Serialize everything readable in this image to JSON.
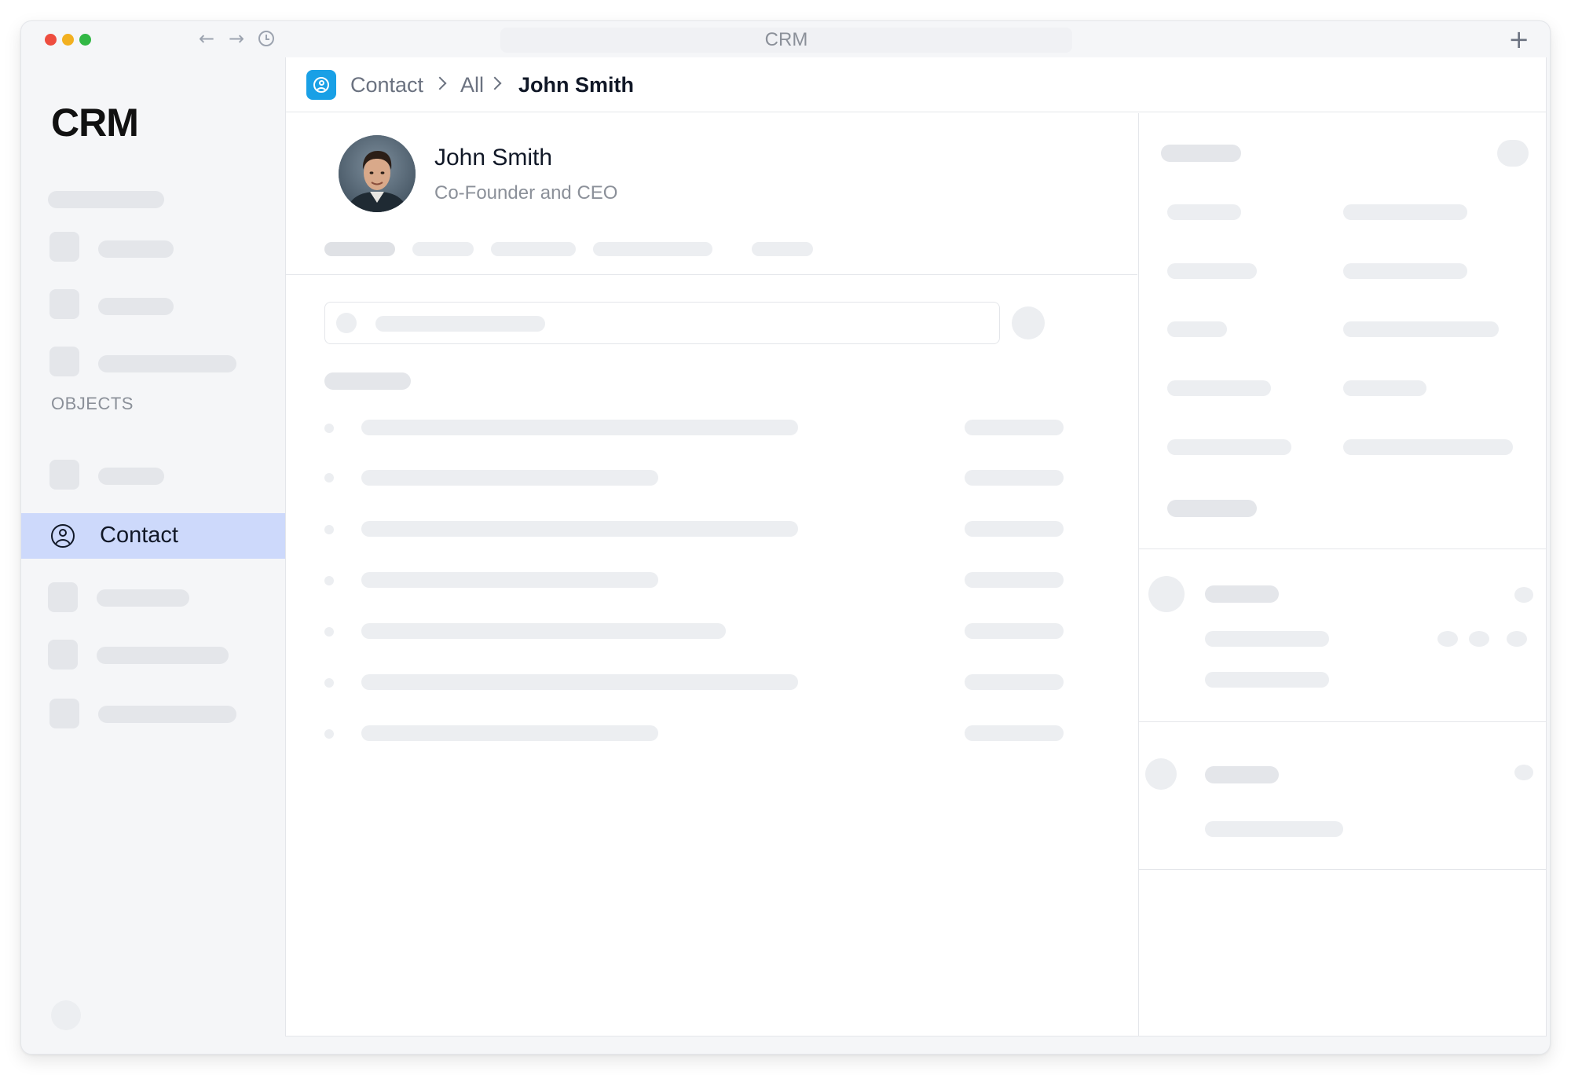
{
  "window": {
    "title": "CRM",
    "new_tab_label": "+",
    "nav": {
      "back": "←",
      "forward": "→"
    }
  },
  "sidebar": {
    "logo": "CRM",
    "section_label": "OBJECTS",
    "active_item": {
      "label": "Contact",
      "icon": "person-circle-icon"
    }
  },
  "breadcrumb": {
    "icon": "contact-badge-icon",
    "items": [
      "Contact",
      "All",
      "John Smith"
    ]
  },
  "profile": {
    "name": "John Smith",
    "role": "Co-Founder and CEO",
    "avatar": "avatar-photo"
  },
  "colors": {
    "accent": "#19a0e6",
    "active_nav": "#cdd9fb",
    "skeleton": "#e4e6ea"
  }
}
